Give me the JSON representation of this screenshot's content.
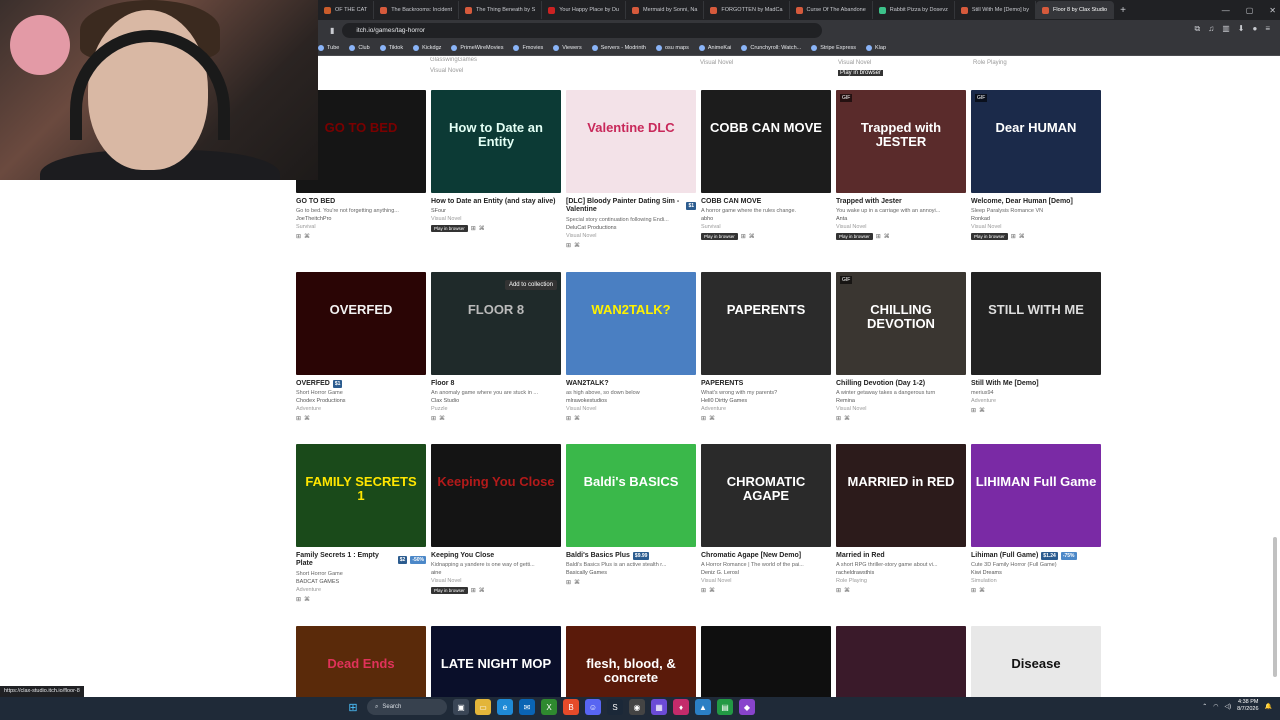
{
  "browser": {
    "tabs": [
      {
        "label": "OF THE CAT",
        "color": "#c95c2b"
      },
      {
        "label": "The Backrooms: Incident",
        "color": "#d65a3c"
      },
      {
        "label": "The Thing Beneath by S",
        "color": "#d65a3c"
      },
      {
        "label": "Your Happy Place by Du",
        "color": "#cc2222"
      },
      {
        "label": "Mermaid by Sonni, Na",
        "color": "#d65a3c"
      },
      {
        "label": "FORGOTTEN by MadCa",
        "color": "#d65a3c"
      },
      {
        "label": "Curse Of The Abandone",
        "color": "#d65a3c"
      },
      {
        "label": "Rabbit Pizza by Dosevz",
        "color": "#3cc28a"
      },
      {
        "label": "Still With Me [Demo] by",
        "color": "#d65a3c"
      },
      {
        "label": "Floor 8 by Clax Studio",
        "color": "#d65a3c"
      }
    ],
    "new_tab": "+",
    "url": "itch.io/games/tag-horror",
    "bookmarks": [
      "Tube",
      "Club",
      "Tiktok",
      "Kickdgz",
      "PrimeWireMovies",
      "Fmovies",
      "Viewers",
      "Servers - Modrinth",
      "osu maps",
      "AnimeKai",
      "Crunchyroll: Watch...",
      "Stripe Express",
      "Klap"
    ]
  },
  "page": {
    "top_row": {
      "c1_author": "GlasswingGames",
      "c1_genre": "Visual Novel",
      "c3_genre": "Visual Novel",
      "c4_genre": "Visual Novel",
      "c5_genre": "Role Playing",
      "play_label": "Play in browser"
    },
    "rows": [
      [
        {
          "thumb_text": "GO TO BED",
          "bg": "#151515",
          "fg": "#7a0000",
          "title": "GO TO BED",
          "desc": "Go to bed. You're not forgetting anything...",
          "author": "JoeTheitchPro",
          "genre": "Survival",
          "play": ""
        },
        {
          "thumb_text": "How to Date an Entity",
          "bg": "#0c3a35",
          "fg": "#e3fff5",
          "title": "How to Date an Entity (and stay alive)",
          "desc": "",
          "author": "SFour",
          "genre": "Visual Novel",
          "play": "Play in browser"
        },
        {
          "thumb_text": "Valentine DLC",
          "bg": "#f3e2e8",
          "fg": "#c8285a",
          "title": "[DLC] Bloody Painter Dating Sim - Valentine",
          "price": "$1",
          "desc": "Special story continuation following Endi...",
          "author": "DeluCat Productions",
          "genre": "Visual Novel",
          "play": ""
        },
        {
          "thumb_text": "COBB CAN MOVE",
          "bg": "#1c1c1c",
          "fg": "#ffffff",
          "title": "COBB CAN MOVE",
          "desc": "A horror game where the rules change.",
          "author": "abho",
          "genre": "Survival",
          "play": "Play in browser"
        },
        {
          "thumb_text": "Trapped with JESTER",
          "bg": "#5a2b2b",
          "fg": "#ffffff",
          "title": "Trapped with Jester",
          "desc": "You wake up in a carriage with an annoyi...",
          "author": "Anta",
          "genre": "Visual Novel",
          "play": "Play in browser",
          "gif": "GIF"
        },
        {
          "thumb_text": "Dear HUMAN",
          "bg": "#1b2a4a",
          "fg": "#ffffff",
          "title": "Welcome, Dear Human [Demo]",
          "desc": "Sleep Paralysis Romance VN",
          "author": "Ronkad",
          "genre": "Visual Novel",
          "play": "Play in browser",
          "gif": "GIF"
        }
      ],
      [
        {
          "thumb_text": "OVERFED",
          "bg": "#2a0505",
          "fg": "#f2f2f2",
          "title": "OVERFED",
          "price": "$1",
          "desc": "Short Horror Game",
          "author": "Chodex Productions",
          "genre": "Adventure",
          "play": ""
        },
        {
          "thumb_text": "FLOOR 8",
          "bg": "#1f2a2a",
          "fg": "#bbbbbb",
          "title": "Floor 8",
          "desc": "An anomaly game where you are stuck in ...",
          "author": "Clax Studio",
          "genre": "Puzzle",
          "play": "",
          "addcol": "Add to collection"
        },
        {
          "thumb_text": "WAN2TALK?",
          "bg": "#4a7fc2",
          "fg": "#fff200",
          "title": "WAN2TALK?",
          "desc": "as high above, so down below",
          "author": "mlrawokestudios",
          "genre": "Visual Novel",
          "play": ""
        },
        {
          "thumb_text": "PAPERENTS",
          "bg": "#2b2b2b",
          "fg": "#ffffff",
          "title": "PAPERENTS",
          "desc": "What's wrong with my parents?",
          "author": "Hell0 Dirtty Games",
          "genre": "Adventure",
          "play": ""
        },
        {
          "thumb_text": "CHILLING DEVOTION",
          "bg": "#3a3631",
          "fg": "#ffffff",
          "title": "Chilling Devotion (Day 1-2)",
          "desc": "A winter getaway takes a dangerous turn",
          "author": "Remina",
          "genre": "Visual Novel",
          "play": "",
          "gif": "GIF"
        },
        {
          "thumb_text": "STILL WITH ME",
          "bg": "#222222",
          "fg": "#dddddd",
          "title": "Still With Me [Demo]",
          "desc": "merius94",
          "author": "",
          "genre": "Adventure",
          "play": ""
        }
      ],
      [
        {
          "thumb_text": "FAMILY SECRETS 1",
          "bg": "#1a4a1a",
          "fg": "#ffe600",
          "title": "Family Secrets 1 : Empty Plate",
          "price": "$2",
          "sale": "-50%",
          "desc": "Short Horror Game",
          "author": "BADCAT GAMES",
          "genre": "Adventure",
          "play": ""
        },
        {
          "thumb_text": "Keeping You Close",
          "bg": "#141414",
          "fg": "#b31a1a",
          "title": "Keeping You Close",
          "desc": "Kidnapping a yandere is one way of getti...",
          "author": "aine",
          "genre": "Visual Novel",
          "play": "Play in browser"
        },
        {
          "thumb_text": "Baldi's BASICS",
          "bg": "#3ab84a",
          "fg": "#ffffff",
          "title": "Baldi's Basics Plus",
          "price": "$9.99",
          "desc": "Baldi's Basics Plus is an active stealth r...",
          "author": "Basically Games",
          "genre": "",
          "play": ""
        },
        {
          "thumb_text": "CHROMATIC AGAPE",
          "bg": "#2a2a2a",
          "fg": "#ffffff",
          "title": "Chromatic Agape [New Demo]",
          "desc": "A Horror Romance | The world of the pai...",
          "author": "Deniz G. Lerosl",
          "genre": "Visual Novel",
          "play": ""
        },
        {
          "thumb_text": "MARRIED in RED",
          "bg": "#2c1b1b",
          "fg": "#ffffff",
          "title": "Married in Red",
          "desc": "A short RPG thriller-story game about vi...",
          "author": "racheldrawsthis",
          "genre": "Role Playing",
          "play": ""
        },
        {
          "thumb_text": "LIHIMAN Full Game",
          "bg": "#7a2aa5",
          "fg": "#ffffff",
          "title": "Lihiman (Full Game)",
          "price": "$1.24",
          "sale": "-75%",
          "desc": "Cute 3D Family Horror (Full Game)",
          "author": "Kiwi Dreams",
          "genre": "Simulation",
          "play": ""
        }
      ],
      [
        {
          "thumb_text": "Dead Ends",
          "bg": "#5a2a0a",
          "fg": "#e0325a"
        },
        {
          "thumb_text": "LATE NIGHT MOP",
          "bg": "#0a0f2a",
          "fg": "#ffffff"
        },
        {
          "thumb_text": "flesh, blood, & concrete",
          "bg": "#5a1a0a",
          "fg": "#ffffff"
        },
        {
          "thumb_text": "",
          "bg": "#0f0f0f",
          "fg": "#ffffff"
        },
        {
          "thumb_text": "",
          "bg": "#3a1a2a",
          "fg": "#ffffff"
        },
        {
          "thumb_text": "Disease",
          "bg": "#e8e8e8",
          "fg": "#111111"
        }
      ]
    ]
  },
  "status_url": "https://clax-studio.itch.io/floor-8",
  "taskbar": {
    "search": "Search",
    "time": "4:38 PM",
    "date": "8/7/2026"
  }
}
